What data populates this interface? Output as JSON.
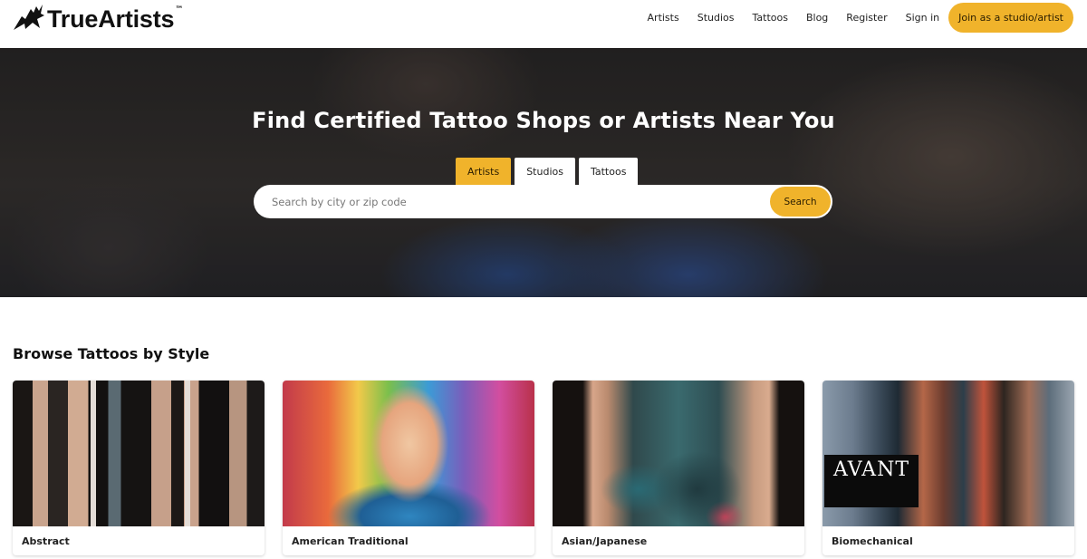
{
  "header": {
    "logo_text": "TrueArtists",
    "logo_tm": "™",
    "nav": [
      "Artists",
      "Studios",
      "Tattoos",
      "Blog",
      "Register",
      "Sign in"
    ],
    "cta": "Join as a studio/artist"
  },
  "hero": {
    "title": "Find Certified Tattoo Shops or Artists Near You",
    "tabs": [
      "Artists",
      "Studios",
      "Tattoos"
    ],
    "active_tab": "Artists",
    "search_placeholder": "Search by city or zip code",
    "search_value": "",
    "search_button": "Search"
  },
  "browse": {
    "title": "Browse Tattoos by Style",
    "cards": [
      {
        "label": "Abstract"
      },
      {
        "label": "American Traditional"
      },
      {
        "label": "Asian/Japanese"
      },
      {
        "label": "Biomechanical",
        "image_overlay_text": "AVANT"
      }
    ]
  },
  "colors": {
    "accent": "#f0b32b",
    "text": "#111111",
    "hero_overlay": "#2c2a2a"
  }
}
